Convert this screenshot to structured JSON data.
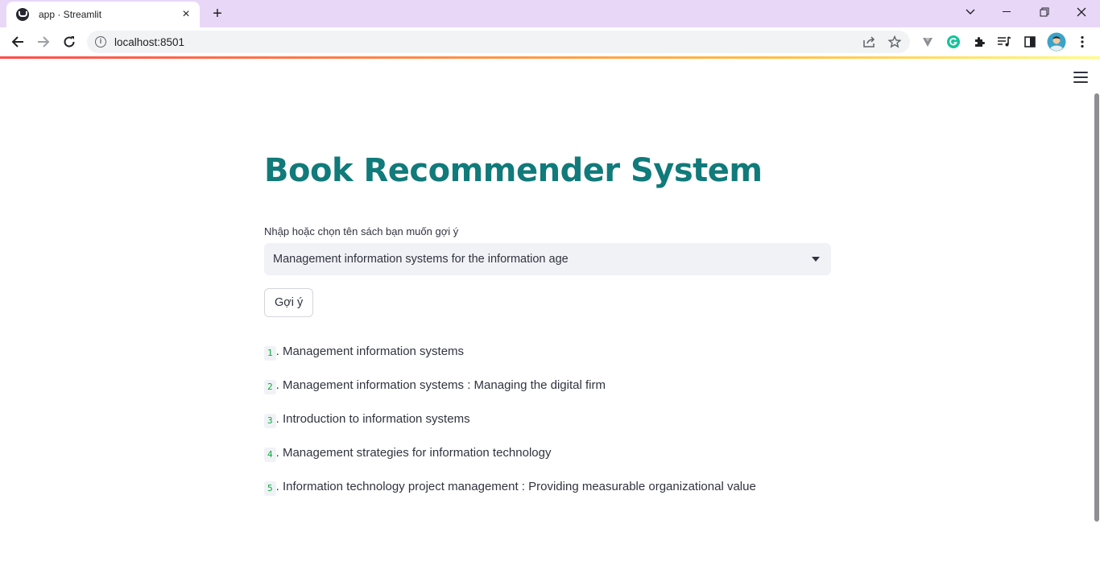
{
  "browser": {
    "tab_title": "app · Streamlit",
    "tab_close": "×",
    "new_tab": "+",
    "url": "localhost:8501",
    "info_glyph": "i"
  },
  "icons": {
    "favicon": "streamlit-crown-icon",
    "back": "back-arrow-icon",
    "forward": "forward-arrow-icon",
    "reload": "reload-icon",
    "share": "share-icon",
    "star": "star-icon",
    "extension_v": "vee-extension-icon",
    "grammarly": "grammarly-icon",
    "puzzle": "puzzle-extension-icon",
    "media": "media-control-icon",
    "sidepanel": "side-panel-icon",
    "profile": "profile-avatar-icon",
    "kebab": "kebab-menu-icon",
    "hamburger": "hamburger-menu-icon"
  },
  "colors": {
    "title": "#117a7a",
    "text": "#31333f",
    "accent_number": "#09ab3b",
    "tabstrip": "#e8d7f7",
    "grammarly": "#15c39a"
  },
  "app": {
    "title": "Book Recommender System",
    "select_label": "Nhập hoặc chọn tên sách bạn muốn gợi ý",
    "selected_book": "Management information systems for the information age",
    "button_label": "Gợi ý",
    "recommendations": [
      {
        "num": "1",
        "text": ". Management information systems"
      },
      {
        "num": "2",
        "text": ". Management information systems : Managing the digital firm"
      },
      {
        "num": "3",
        "text": ". Introduction to information systems"
      },
      {
        "num": "4",
        "text": ". Management strategies for information technology"
      },
      {
        "num": "5",
        "text": ". Information technology project management : Providing measurable organizational value"
      }
    ]
  }
}
